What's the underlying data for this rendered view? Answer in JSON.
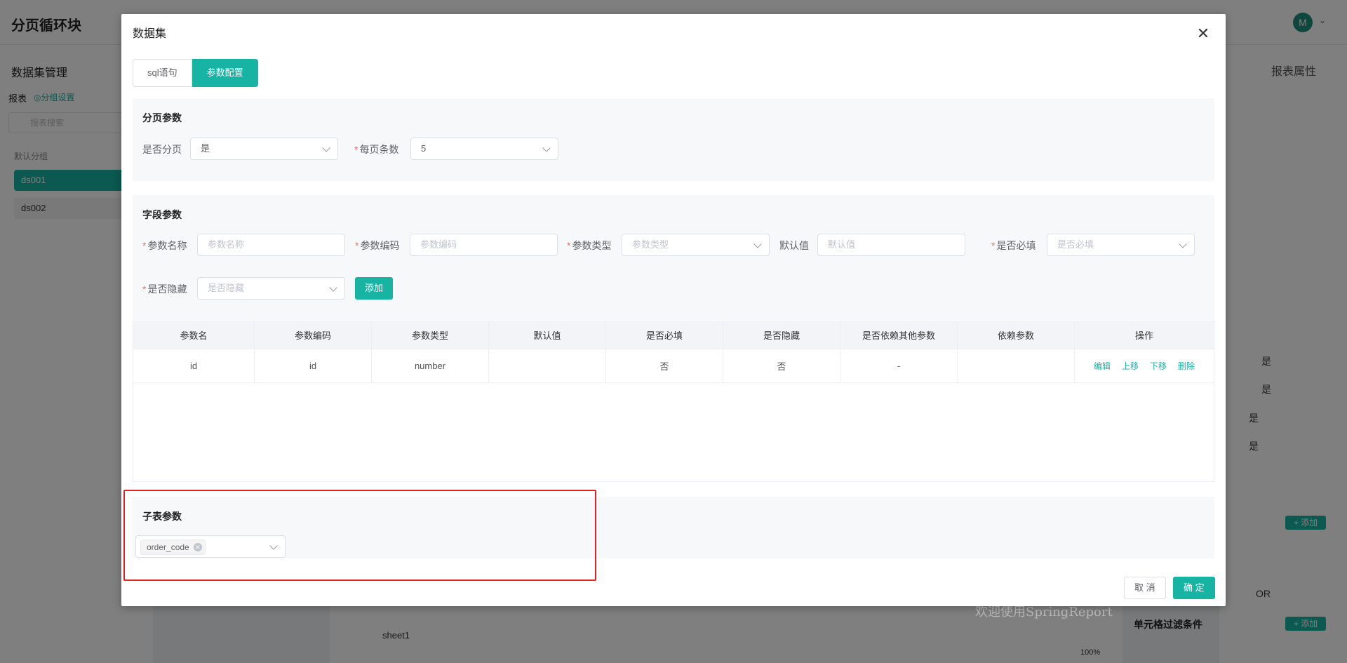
{
  "app": {
    "title": "分页循环块",
    "avatar_letter": "M",
    "left_panel": {
      "title": "数据集管理",
      "report_label": "报表",
      "group_settings": "◎分组设置",
      "search_placeholder": "报表搜索",
      "default_group": "默认分组",
      "datasets": [
        "ds001",
        "ds002"
      ]
    },
    "right_panel": {
      "title": "报表属性",
      "toggle_label": "是",
      "add_label": "+ 添加",
      "or_label": "OR",
      "cell_filter_label": "单元格过滤条件"
    },
    "sheet": {
      "tab": "sheet1",
      "zoom": "100%"
    },
    "watermark": "欢迎使用SpringReport"
  },
  "dialog": {
    "title": "数据集",
    "tabs": [
      {
        "label": "sql语句",
        "active": false
      },
      {
        "label": "参数配置",
        "active": true
      }
    ],
    "paging": {
      "title": "分页参数",
      "is_paging_label": "是否分页",
      "is_paging_value": "是",
      "page_size_label": "每页条数",
      "page_size_value": "5"
    },
    "fields": {
      "title": "字段参数",
      "param_name_label": "参数名称",
      "param_name_placeholder": "参数名称",
      "param_code_label": "参数编码",
      "param_code_placeholder": "参数编码",
      "param_type_label": "参数类型",
      "param_type_placeholder": "参数类型",
      "default_label": "默认值",
      "default_placeholder": "默认值",
      "required_label": "是否必填",
      "required_placeholder": "是否必填",
      "hidden_label": "是否隐藏",
      "hidden_placeholder": "是否隐藏",
      "add_button": "添加"
    },
    "table": {
      "headers": [
        "参数名",
        "参数编码",
        "参数类型",
        "默认值",
        "是否必填",
        "是否隐藏",
        "是否依赖其他参数",
        "依赖参数",
        "操作"
      ],
      "rows": [
        {
          "name": "id",
          "code": "id",
          "type": "number",
          "default": "",
          "required": "否",
          "hidden": "否",
          "depends": "-",
          "dep_param": ""
        }
      ],
      "actions": [
        "编辑",
        "上移",
        "下移",
        "删除"
      ]
    },
    "sub_params": {
      "title": "子表参数",
      "selected_tag": "order_code"
    },
    "footer": {
      "cancel": "取 消",
      "confirm": "确 定"
    }
  }
}
